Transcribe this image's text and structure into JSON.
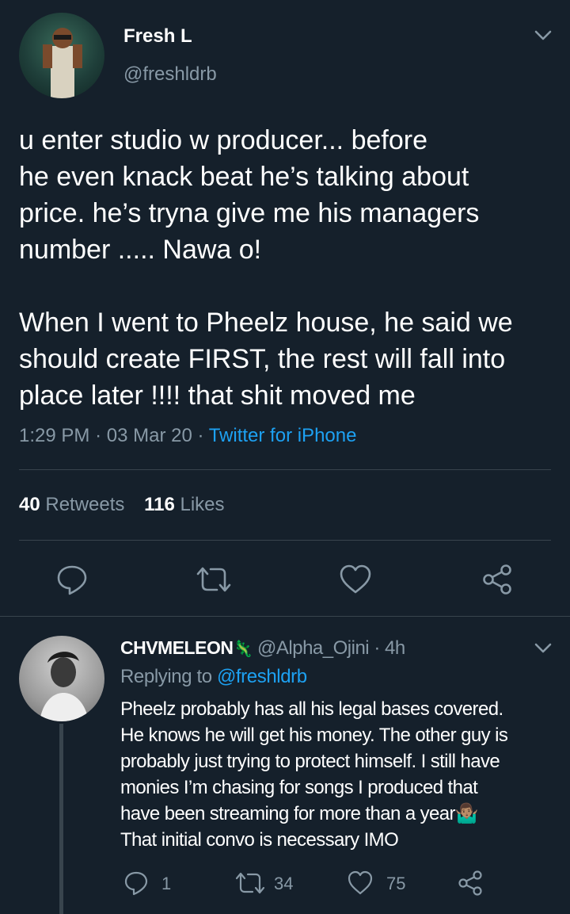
{
  "main_tweet": {
    "author_name": "Fresh L",
    "author_handle": "@freshldrb",
    "text_lines": [
      "u enter studio w producer... before",
      "he even knack beat he’s talking about",
      "price. he’s tryna give me his managers",
      "number ..... Nawa o!",
      "",
      "When I went to Pheelz house, he said we",
      "should create FIRST, the rest will fall into",
      "place later !!!! that shit moved me"
    ],
    "time": "1:29 PM",
    "date": "03 Mar 20",
    "source": "Twitter for iPhone",
    "retweets_count": "40",
    "retweets_label": "Retweets",
    "likes_count": "116",
    "likes_label": "Likes"
  },
  "reply": {
    "author_name": "CHVMELEON",
    "author_emoji": "🦎",
    "author_handle": "@Alpha_Ojini",
    "age": "4h",
    "replying_label": "Replying to",
    "replying_to": "@freshldrb",
    "text_lines": [
      "Pheelz probably has all his legal bases covered.",
      "He knows he will get his money. The other guy is",
      "probably just trying to protect himself. I still have",
      "monies I’m chasing for songs I produced that",
      "have been streaming for more than a year🤷🏽‍♂️",
      "That initial convo is necessary IMO"
    ],
    "reply_count": "1",
    "retweet_count": "34",
    "like_count": "75"
  },
  "colors": {
    "background": "#15202b",
    "text": "#ffffff",
    "muted": "#8899a6",
    "accent": "#1da1f2",
    "divider": "#38444d"
  },
  "icons": [
    "chevron-down-icon",
    "reply-icon",
    "retweet-icon",
    "like-icon",
    "share-icon"
  ]
}
